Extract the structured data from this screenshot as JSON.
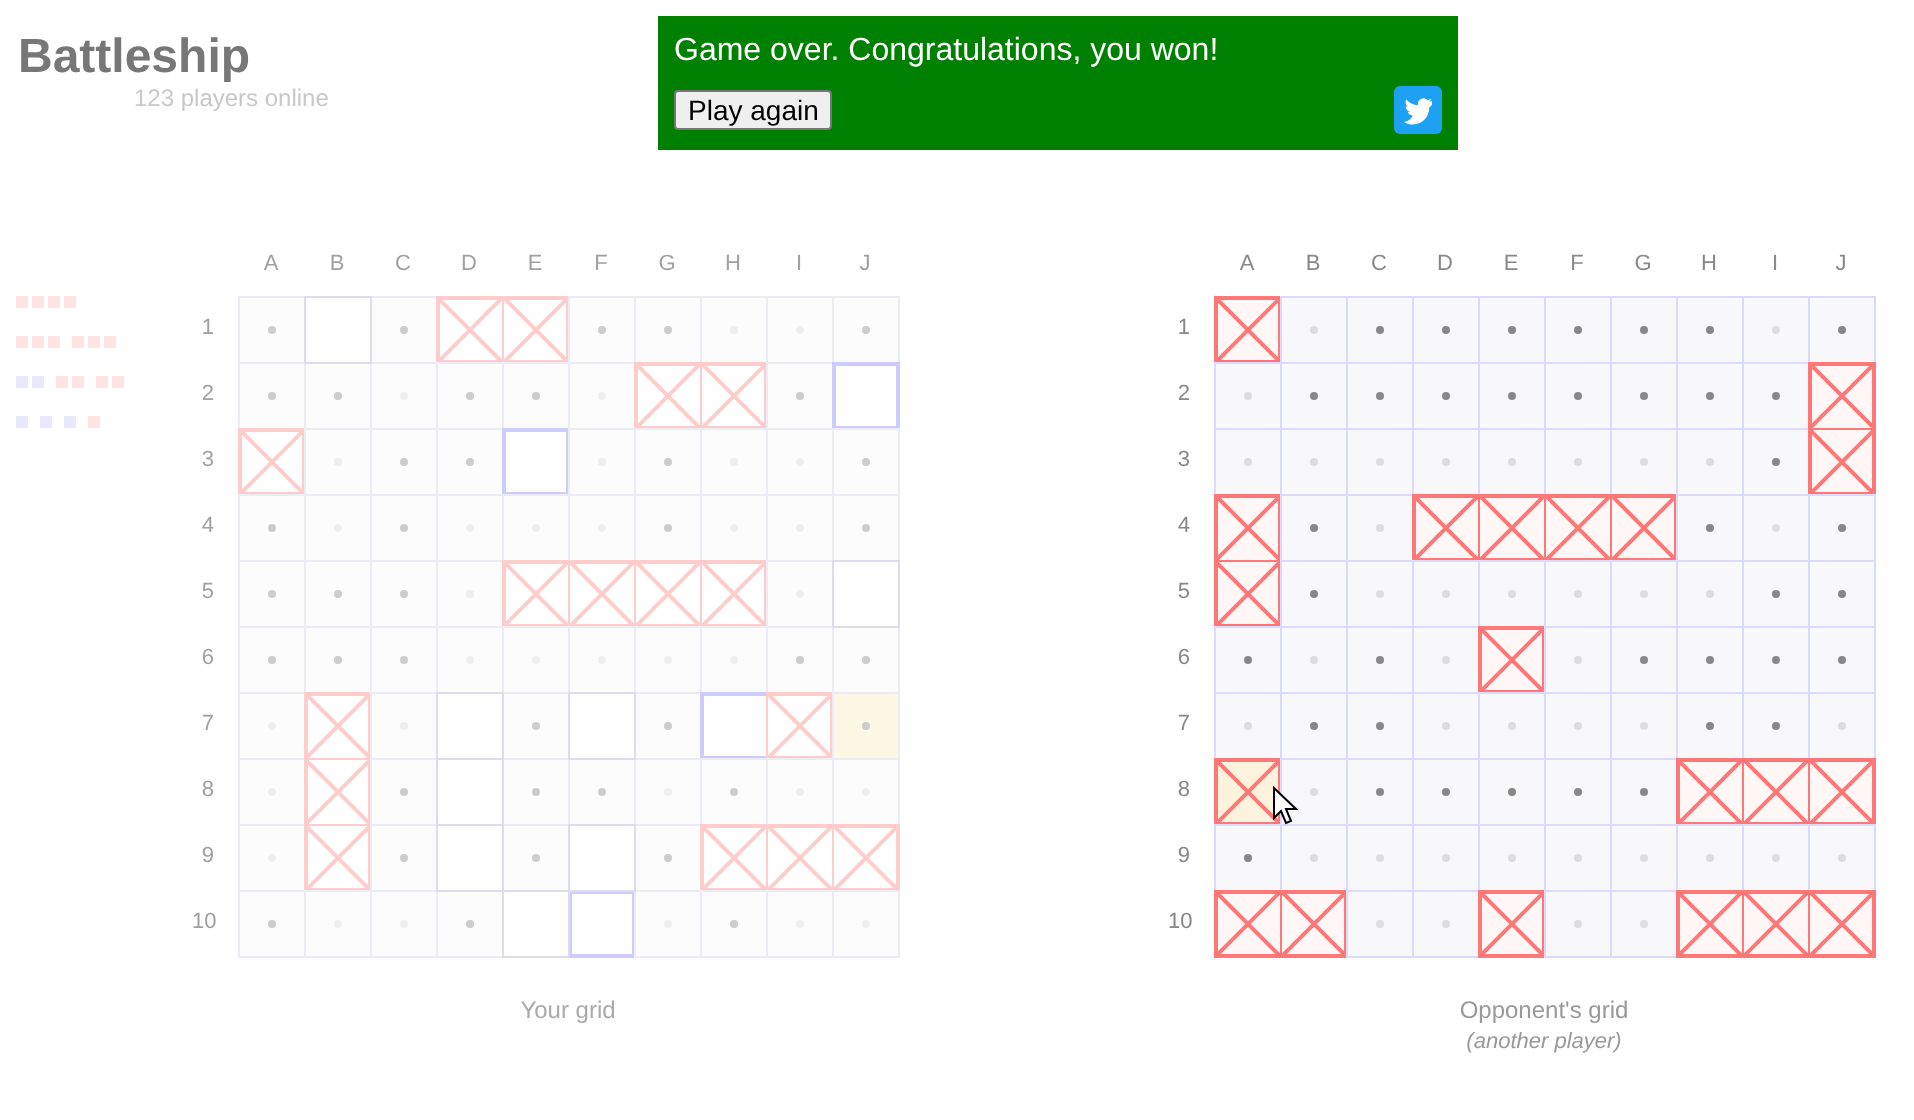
{
  "header": {
    "title": "Battleship",
    "online": "123 players online"
  },
  "banner": {
    "message": "Game over. Congratulations, you won!",
    "button": "Play again"
  },
  "fleet": [
    {
      "ships": [
        {
          "segments": [
            {
              "sunk": true
            },
            {
              "sunk": true
            },
            {
              "sunk": true
            },
            {
              "sunk": true
            }
          ]
        }
      ]
    },
    {
      "ships": [
        {
          "segments": [
            {
              "sunk": true
            },
            {
              "sunk": true
            },
            {
              "sunk": true
            }
          ]
        },
        {
          "segments": [
            {
              "sunk": true
            },
            {
              "sunk": true
            },
            {
              "sunk": true
            }
          ]
        }
      ]
    },
    {
      "ships": [
        {
          "segments": [
            {
              "sunk": false
            },
            {
              "sunk": false
            }
          ]
        },
        {
          "segments": [
            {
              "sunk": true
            },
            {
              "sunk": true
            }
          ]
        },
        {
          "segments": [
            {
              "sunk": true
            },
            {
              "sunk": true
            }
          ]
        }
      ]
    },
    {
      "ships": [
        {
          "segments": [
            {
              "sunk": false
            }
          ]
        },
        {
          "segments": [
            {
              "sunk": false
            }
          ]
        },
        {
          "segments": [
            {
              "sunk": false
            }
          ]
        },
        {
          "segments": [
            {
              "sunk": true
            }
          ]
        }
      ]
    }
  ],
  "boards": [
    {
      "kind": "own",
      "active": false,
      "caption": "Your grid",
      "columns": [
        "A",
        "B",
        "C",
        "D",
        "E",
        "F",
        "G",
        "H",
        "I",
        "J"
      ],
      "rows": [
        {
          "label": "1",
          "cells": [
            {
              "kind": "miss",
              "highlighted": false
            },
            {
              "kind": "empty",
              "highlighted": false
            },
            {
              "kind": "miss",
              "highlighted": false
            },
            {
              "kind": "hit",
              "highlighted": false
            },
            {
              "kind": "hit",
              "highlighted": false
            },
            {
              "kind": "miss",
              "highlighted": false
            },
            {
              "kind": "miss",
              "highlighted": false
            },
            {
              "kind": "near",
              "highlighted": false
            },
            {
              "kind": "near",
              "highlighted": false
            },
            {
              "kind": "miss",
              "highlighted": false
            }
          ]
        },
        {
          "label": "2",
          "cells": [
            {
              "kind": "miss",
              "highlighted": false
            },
            {
              "kind": "miss",
              "highlighted": false
            },
            {
              "kind": "near",
              "highlighted": false
            },
            {
              "kind": "miss",
              "highlighted": false
            },
            {
              "kind": "miss",
              "highlighted": false
            },
            {
              "kind": "near",
              "highlighted": false
            },
            {
              "kind": "hit",
              "highlighted": false
            },
            {
              "kind": "hit",
              "highlighted": false
            },
            {
              "kind": "miss",
              "highlighted": false
            },
            {
              "kind": "ship",
              "highlighted": false
            }
          ]
        },
        {
          "label": "3",
          "cells": [
            {
              "kind": "hit",
              "highlighted": false
            },
            {
              "kind": "near",
              "highlighted": false
            },
            {
              "kind": "miss",
              "highlighted": false
            },
            {
              "kind": "miss",
              "highlighted": false
            },
            {
              "kind": "ship",
              "highlighted": false
            },
            {
              "kind": "near",
              "highlighted": false
            },
            {
              "kind": "miss",
              "highlighted": false
            },
            {
              "kind": "near",
              "highlighted": false
            },
            {
              "kind": "near",
              "highlighted": false
            },
            {
              "kind": "miss",
              "highlighted": false
            }
          ]
        },
        {
          "label": "4",
          "cells": [
            {
              "kind": "miss",
              "highlighted": false
            },
            {
              "kind": "near",
              "highlighted": false
            },
            {
              "kind": "miss",
              "highlighted": false
            },
            {
              "kind": "near",
              "highlighted": false
            },
            {
              "kind": "near",
              "highlighted": false
            },
            {
              "kind": "near",
              "highlighted": false
            },
            {
              "kind": "miss",
              "highlighted": false
            },
            {
              "kind": "near",
              "highlighted": false
            },
            {
              "kind": "near",
              "highlighted": false
            },
            {
              "kind": "miss",
              "highlighted": false
            }
          ]
        },
        {
          "label": "5",
          "cells": [
            {
              "kind": "miss",
              "highlighted": false
            },
            {
              "kind": "miss",
              "highlighted": false
            },
            {
              "kind": "miss",
              "highlighted": false
            },
            {
              "kind": "near",
              "highlighted": false
            },
            {
              "kind": "hit",
              "highlighted": false
            },
            {
              "kind": "hit",
              "highlighted": false
            },
            {
              "kind": "hit",
              "highlighted": false
            },
            {
              "kind": "hit",
              "highlighted": false
            },
            {
              "kind": "near",
              "highlighted": false
            },
            {
              "kind": "empty",
              "highlighted": false
            }
          ]
        },
        {
          "label": "6",
          "cells": [
            {
              "kind": "miss",
              "highlighted": false
            },
            {
              "kind": "miss",
              "highlighted": false
            },
            {
              "kind": "miss",
              "highlighted": false
            },
            {
              "kind": "near",
              "highlighted": false
            },
            {
              "kind": "near",
              "highlighted": false
            },
            {
              "kind": "near",
              "highlighted": false
            },
            {
              "kind": "near",
              "highlighted": false
            },
            {
              "kind": "near",
              "highlighted": false
            },
            {
              "kind": "miss",
              "highlighted": false
            },
            {
              "kind": "miss",
              "highlighted": false
            }
          ]
        },
        {
          "label": "7",
          "cells": [
            {
              "kind": "near",
              "highlighted": false
            },
            {
              "kind": "hit",
              "highlighted": false
            },
            {
              "kind": "near",
              "highlighted": false
            },
            {
              "kind": "empty",
              "highlighted": false
            },
            {
              "kind": "miss",
              "highlighted": false
            },
            {
              "kind": "empty",
              "highlighted": false
            },
            {
              "kind": "miss",
              "highlighted": false
            },
            {
              "kind": "ship",
              "highlighted": false
            },
            {
              "kind": "hit",
              "highlighted": false
            },
            {
              "kind": "miss",
              "highlighted": true
            }
          ]
        },
        {
          "label": "8",
          "cells": [
            {
              "kind": "near",
              "highlighted": false
            },
            {
              "kind": "hit",
              "highlighted": false
            },
            {
              "kind": "miss",
              "highlighted": false
            },
            {
              "kind": "empty",
              "highlighted": false
            },
            {
              "kind": "miss",
              "highlighted": false
            },
            {
              "kind": "miss",
              "highlighted": false
            },
            {
              "kind": "near",
              "highlighted": false
            },
            {
              "kind": "miss",
              "highlighted": false
            },
            {
              "kind": "near",
              "highlighted": false
            },
            {
              "kind": "near",
              "highlighted": false
            }
          ]
        },
        {
          "label": "9",
          "cells": [
            {
              "kind": "near",
              "highlighted": false
            },
            {
              "kind": "hit",
              "highlighted": false
            },
            {
              "kind": "miss",
              "highlighted": false
            },
            {
              "kind": "empty",
              "highlighted": false
            },
            {
              "kind": "miss",
              "highlighted": false
            },
            {
              "kind": "empty",
              "highlighted": false
            },
            {
              "kind": "miss",
              "highlighted": false
            },
            {
              "kind": "hit",
              "highlighted": false
            },
            {
              "kind": "hit",
              "highlighted": false
            },
            {
              "kind": "hit",
              "highlighted": false
            }
          ]
        },
        {
          "label": "10",
          "cells": [
            {
              "kind": "miss",
              "highlighted": false
            },
            {
              "kind": "near",
              "highlighted": false
            },
            {
              "kind": "near",
              "highlighted": false
            },
            {
              "kind": "miss",
              "highlighted": false
            },
            {
              "kind": "empty",
              "highlighted": false
            },
            {
              "kind": "ship",
              "highlighted": false
            },
            {
              "kind": "near",
              "highlighted": false
            },
            {
              "kind": "miss",
              "highlighted": false
            },
            {
              "kind": "near",
              "highlighted": false
            },
            {
              "kind": "near",
              "highlighted": false
            }
          ]
        }
      ]
    },
    {
      "kind": "opponent",
      "active": true,
      "caption": "Opponent's grid",
      "subcaption": "(another player)",
      "columns": [
        "A",
        "B",
        "C",
        "D",
        "E",
        "F",
        "G",
        "H",
        "I",
        "J"
      ],
      "rows": [
        {
          "label": "1",
          "cells": [
            {
              "kind": "hit",
              "highlighted": false
            },
            {
              "kind": "near",
              "highlighted": false
            },
            {
              "kind": "miss",
              "highlighted": false
            },
            {
              "kind": "miss",
              "highlighted": false
            },
            {
              "kind": "miss",
              "highlighted": false
            },
            {
              "kind": "miss",
              "highlighted": false
            },
            {
              "kind": "miss",
              "highlighted": false
            },
            {
              "kind": "miss",
              "highlighted": false
            },
            {
              "kind": "near",
              "highlighted": false
            },
            {
              "kind": "miss",
              "highlighted": false
            }
          ]
        },
        {
          "label": "2",
          "cells": [
            {
              "kind": "near",
              "highlighted": false
            },
            {
              "kind": "miss",
              "highlighted": false
            },
            {
              "kind": "miss",
              "highlighted": false
            },
            {
              "kind": "miss",
              "highlighted": false
            },
            {
              "kind": "miss",
              "highlighted": false
            },
            {
              "kind": "miss",
              "highlighted": false
            },
            {
              "kind": "miss",
              "highlighted": false
            },
            {
              "kind": "miss",
              "highlighted": false
            },
            {
              "kind": "miss",
              "highlighted": false
            },
            {
              "kind": "hit",
              "highlighted": false
            }
          ]
        },
        {
          "label": "3",
          "cells": [
            {
              "kind": "near",
              "highlighted": false
            },
            {
              "kind": "near",
              "highlighted": false
            },
            {
              "kind": "near",
              "highlighted": false
            },
            {
              "kind": "near",
              "highlighted": false
            },
            {
              "kind": "near",
              "highlighted": false
            },
            {
              "kind": "near",
              "highlighted": false
            },
            {
              "kind": "near",
              "highlighted": false
            },
            {
              "kind": "near",
              "highlighted": false
            },
            {
              "kind": "miss",
              "highlighted": false
            },
            {
              "kind": "hit",
              "highlighted": false
            }
          ]
        },
        {
          "label": "4",
          "cells": [
            {
              "kind": "hit",
              "highlighted": false
            },
            {
              "kind": "miss",
              "highlighted": false
            },
            {
              "kind": "near",
              "highlighted": false
            },
            {
              "kind": "hit",
              "highlighted": false
            },
            {
              "kind": "hit",
              "highlighted": false
            },
            {
              "kind": "hit",
              "highlighted": false
            },
            {
              "kind": "hit",
              "highlighted": false
            },
            {
              "kind": "miss",
              "highlighted": false
            },
            {
              "kind": "near",
              "highlighted": false
            },
            {
              "kind": "miss",
              "highlighted": false
            }
          ]
        },
        {
          "label": "5",
          "cells": [
            {
              "kind": "hit",
              "highlighted": false
            },
            {
              "kind": "miss",
              "highlighted": false
            },
            {
              "kind": "near",
              "highlighted": false
            },
            {
              "kind": "near",
              "highlighted": false
            },
            {
              "kind": "near",
              "highlighted": false
            },
            {
              "kind": "near",
              "highlighted": false
            },
            {
              "kind": "near",
              "highlighted": false
            },
            {
              "kind": "near",
              "highlighted": false
            },
            {
              "kind": "miss",
              "highlighted": false
            },
            {
              "kind": "miss",
              "highlighted": false
            }
          ]
        },
        {
          "label": "6",
          "cells": [
            {
              "kind": "miss",
              "highlighted": false
            },
            {
              "kind": "near",
              "highlighted": false
            },
            {
              "kind": "miss",
              "highlighted": false
            },
            {
              "kind": "near",
              "highlighted": false
            },
            {
              "kind": "hit",
              "highlighted": false
            },
            {
              "kind": "near",
              "highlighted": false
            },
            {
              "kind": "miss",
              "highlighted": false
            },
            {
              "kind": "miss",
              "highlighted": false
            },
            {
              "kind": "miss",
              "highlighted": false
            },
            {
              "kind": "miss",
              "highlighted": false
            }
          ]
        },
        {
          "label": "7",
          "cells": [
            {
              "kind": "near",
              "highlighted": false
            },
            {
              "kind": "miss",
              "highlighted": false
            },
            {
              "kind": "miss",
              "highlighted": false
            },
            {
              "kind": "near",
              "highlighted": false
            },
            {
              "kind": "near",
              "highlighted": false
            },
            {
              "kind": "near",
              "highlighted": false
            },
            {
              "kind": "near",
              "highlighted": false
            },
            {
              "kind": "miss",
              "highlighted": false
            },
            {
              "kind": "miss",
              "highlighted": false
            },
            {
              "kind": "near",
              "highlighted": false
            }
          ]
        },
        {
          "label": "8",
          "cells": [
            {
              "kind": "hit",
              "highlighted": true
            },
            {
              "kind": "near",
              "highlighted": false
            },
            {
              "kind": "miss",
              "highlighted": false
            },
            {
              "kind": "miss",
              "highlighted": false
            },
            {
              "kind": "miss",
              "highlighted": false
            },
            {
              "kind": "miss",
              "highlighted": false
            },
            {
              "kind": "miss",
              "highlighted": false
            },
            {
              "kind": "hit",
              "highlighted": false
            },
            {
              "kind": "hit",
              "highlighted": false
            },
            {
              "kind": "hit",
              "highlighted": false
            }
          ]
        },
        {
          "label": "9",
          "cells": [
            {
              "kind": "miss",
              "highlighted": false
            },
            {
              "kind": "near",
              "highlighted": false
            },
            {
              "kind": "near",
              "highlighted": false
            },
            {
              "kind": "near",
              "highlighted": false
            },
            {
              "kind": "near",
              "highlighted": false
            },
            {
              "kind": "near",
              "highlighted": false
            },
            {
              "kind": "near",
              "highlighted": false
            },
            {
              "kind": "near",
              "highlighted": false
            },
            {
              "kind": "near",
              "highlighted": false
            },
            {
              "kind": "near",
              "highlighted": false
            }
          ]
        },
        {
          "label": "10",
          "cells": [
            {
              "kind": "hit",
              "highlighted": false
            },
            {
              "kind": "hit",
              "highlighted": false
            },
            {
              "kind": "near",
              "highlighted": false
            },
            {
              "kind": "near",
              "highlighted": false
            },
            {
              "kind": "hit",
              "highlighted": false
            },
            {
              "kind": "near",
              "highlighted": false
            },
            {
              "kind": "near",
              "highlighted": false
            },
            {
              "kind": "hit",
              "highlighted": false
            },
            {
              "kind": "hit",
              "highlighted": false
            },
            {
              "kind": "hit",
              "highlighted": false
            }
          ]
        }
      ]
    }
  ]
}
